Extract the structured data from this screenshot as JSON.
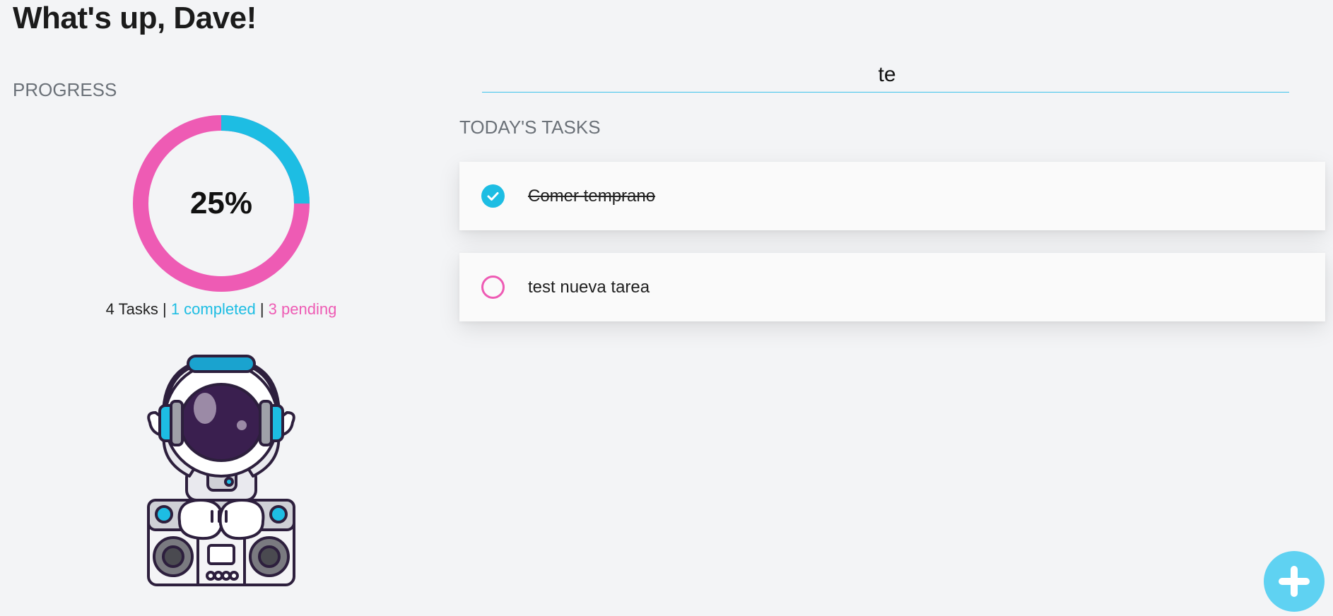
{
  "header": {
    "greeting": "What's up, Dave!"
  },
  "progress": {
    "title": "PROGRESS",
    "percent_label": "25%",
    "completed_fraction": 0.25,
    "total_text": "4 Tasks",
    "separator": "|",
    "completed_text": "1 completed",
    "pending_text": "3 pending",
    "colors": {
      "completed": "#1dbde3",
      "pending": "#ee5bb4"
    }
  },
  "mascot": {
    "icon": "astronaut-dj-illustration"
  },
  "search": {
    "value": "te",
    "placeholder": ""
  },
  "tasks": {
    "title": "TODAY'S TASKS",
    "items": [
      {
        "text": "Comer temprano",
        "completed": true,
        "icon": "check-circle-icon"
      },
      {
        "text": "test nueva tarea",
        "completed": false,
        "icon": "empty-circle-icon"
      }
    ]
  },
  "fab": {
    "icon": "plus-icon",
    "color": "#5fd2f2"
  }
}
